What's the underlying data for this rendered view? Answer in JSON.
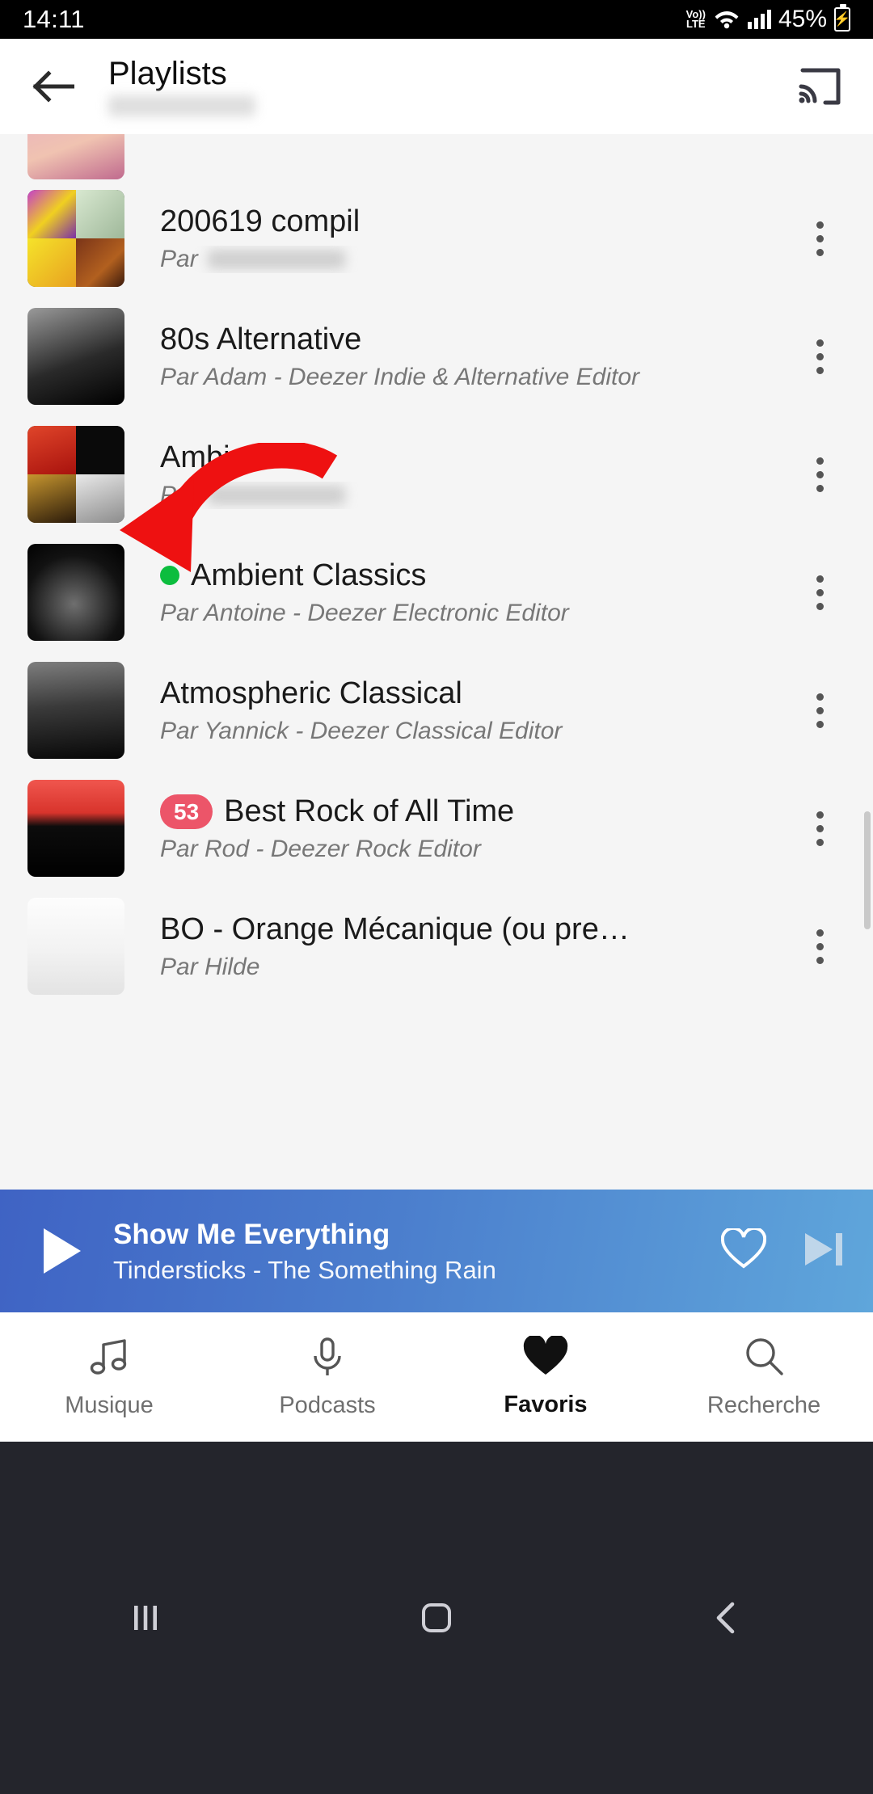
{
  "status_bar": {
    "time": "14:11",
    "network_label_top": "Vo))",
    "network_label_bottom": "LTE",
    "battery_percent": "45%",
    "wifi_icon": "wifi-icon",
    "signal_icon": "cellular-signal-icon",
    "battery_icon": "battery-charging-icon"
  },
  "header": {
    "title": "Playlists",
    "back_icon": "back-arrow-icon",
    "cast_icon": "chromecast-icon",
    "subtitle_redacted": ""
  },
  "playlists": [
    {
      "title": "",
      "author": "",
      "clipped": true,
      "art": "skin-photo-art"
    },
    {
      "title": "200619 compil",
      "author_prefix": "Par",
      "author_redacted": true,
      "art": "collage-art"
    },
    {
      "title": "80s Alternative",
      "author": "Par Adam - Deezer Indie & Alternative Editor",
      "art": "80s-alternative-art"
    },
    {
      "title": "Ambiance",
      "author_prefix": "Par",
      "author_redacted": true,
      "art": "ambiance-collage-art"
    },
    {
      "title": "Ambient Classics",
      "author": "Par Antoine - Deezer Electronic Editor",
      "art": "ambient-classics-art",
      "playing_dot": true
    },
    {
      "title": "Atmospheric Classical",
      "author": "Par Yannick - Deezer Classical Editor",
      "art": "atmospheric-classical-art"
    },
    {
      "title": "Best Rock of All Time",
      "author": "Par Rod - Deezer Rock Editor",
      "art": "best-rock-art",
      "badge": "53"
    },
    {
      "title": "BO - Orange Mécanique (ou pre…",
      "author": "Par Hilde",
      "art": "clockwork-orange-art"
    }
  ],
  "player": {
    "track_title": "Show Me Everything",
    "track_subtitle": "Tindersticks - The Something Rain",
    "play_icon": "play-icon",
    "favorite_icon": "heart-outline-icon",
    "next_icon": "skip-next-icon"
  },
  "bottom_nav": {
    "items": [
      {
        "label": "Musique",
        "icon": "music-note-icon",
        "active": false
      },
      {
        "label": "Podcasts",
        "icon": "microphone-icon",
        "active": false
      },
      {
        "label": "Favoris",
        "icon": "heart-filled-icon",
        "active": true
      },
      {
        "label": "Recherche",
        "icon": "search-icon",
        "active": false
      }
    ]
  },
  "system_nav": {
    "recents_icon": "recents-icon",
    "home_icon": "home-icon",
    "back_icon": "system-back-icon"
  },
  "annotation": {
    "arrow_icon": "red-curved-arrow",
    "arrow_color": "#ee1111"
  },
  "colors": {
    "badge": "#ec5569",
    "playing_dot": "#0cbd3e",
    "player_gradient_start": "#3f63c4",
    "player_gradient_end": "#5fa6db"
  }
}
